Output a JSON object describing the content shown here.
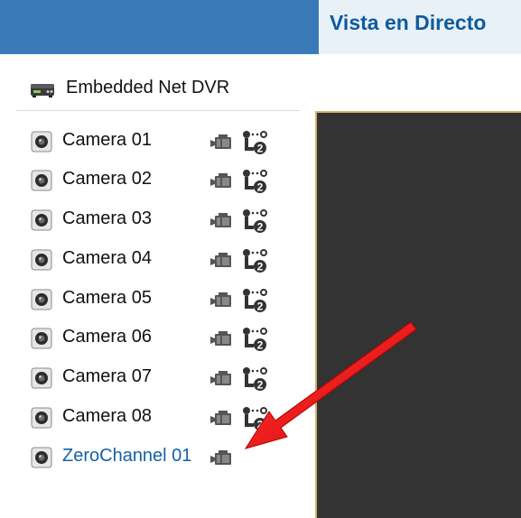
{
  "header": {
    "active_tab": "Vista en Directo"
  },
  "device": {
    "name": "Embedded Net DVR",
    "icon": "dvr-device-icon"
  },
  "channels": [
    {
      "label": "Camera 01",
      "icon": "camera-icon",
      "actions": [
        "record-icon",
        "ptz-icon"
      ]
    },
    {
      "label": "Camera 02",
      "icon": "camera-icon",
      "actions": [
        "record-icon",
        "ptz-icon"
      ]
    },
    {
      "label": "Camera 03",
      "icon": "camera-icon",
      "actions": [
        "record-icon",
        "ptz-icon"
      ]
    },
    {
      "label": "Camera 04",
      "icon": "camera-icon",
      "actions": [
        "record-icon",
        "ptz-icon"
      ]
    },
    {
      "label": "Camera 05",
      "icon": "camera-icon",
      "actions": [
        "record-icon",
        "ptz-icon"
      ]
    },
    {
      "label": "Camera 06",
      "icon": "camera-icon",
      "actions": [
        "record-icon",
        "ptz-icon"
      ]
    },
    {
      "label": "Camera 07",
      "icon": "camera-icon",
      "actions": [
        "record-icon",
        "ptz-icon"
      ]
    },
    {
      "label": "Camera 08",
      "icon": "camera-icon",
      "actions": [
        "record-icon",
        "ptz-icon"
      ]
    },
    {
      "label": "ZeroChannel 01",
      "icon": "camera-icon",
      "actions": [
        "record-icon"
      ]
    }
  ],
  "colors": {
    "top_bar": "#3a7ab8",
    "active_tab_bg": "#e8f1f8",
    "active_tab_text": "#0f5a9e",
    "zero_channel_text": "#1460a8",
    "video_bg": "#333333",
    "annotation_arrow": "#e31010"
  }
}
